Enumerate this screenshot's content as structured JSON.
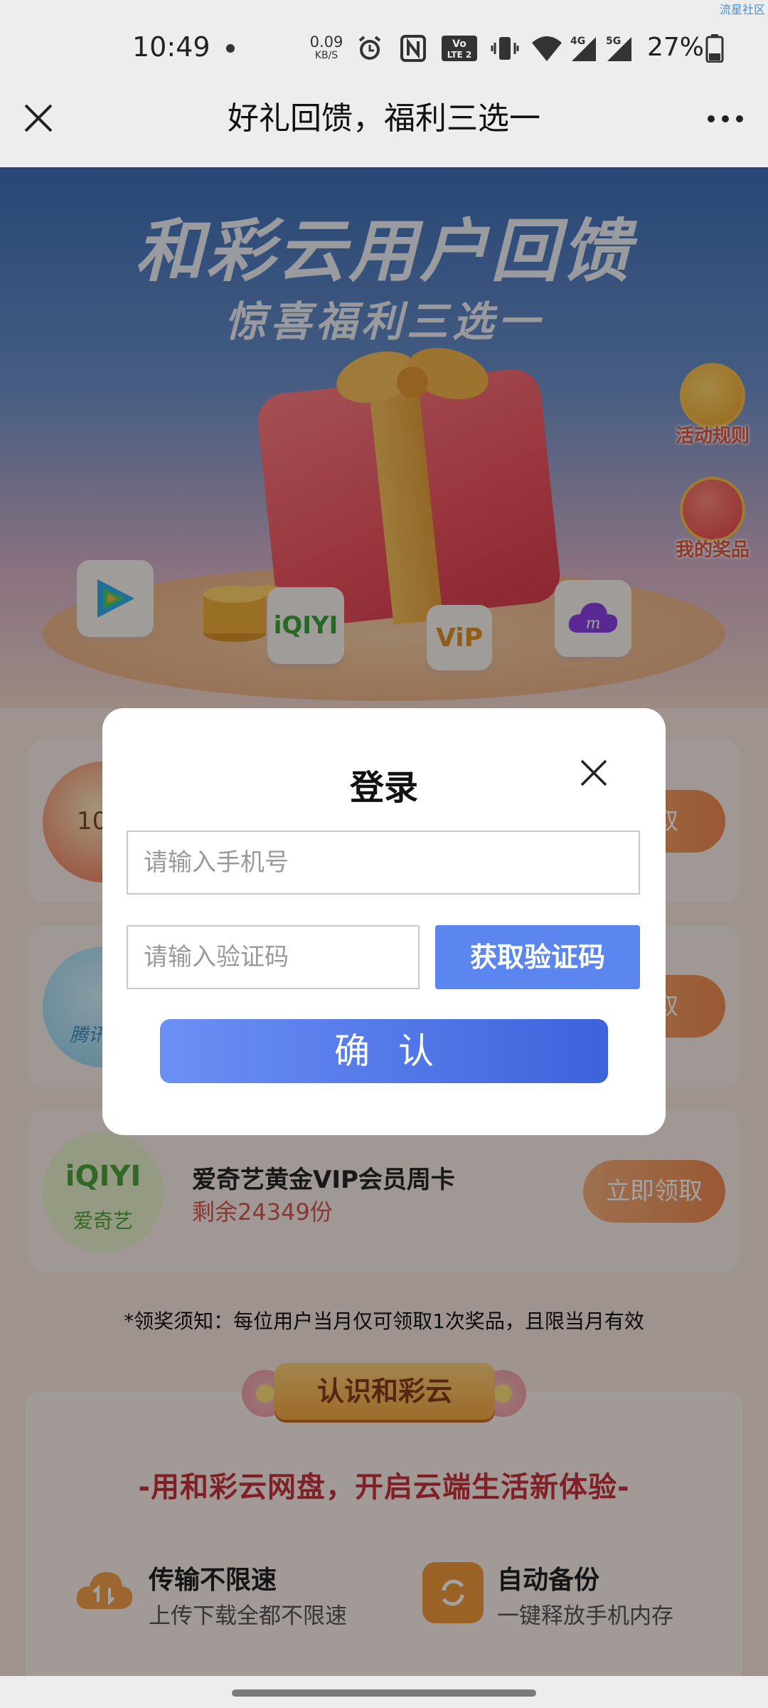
{
  "status_bar": {
    "time": "10:49",
    "net_speed_value": "0.09",
    "net_speed_unit": "KB/S",
    "battery_percent": "27%",
    "icons": [
      "alarm-icon",
      "nfc-icon",
      "volte-icon",
      "vibrate-icon",
      "wifi-icon",
      "signal-4g-icon",
      "signal-5g-icon",
      "battery-icon"
    ],
    "watermark": "流星社区"
  },
  "nav": {
    "title": "好礼回馈，福利三选一",
    "close_icon": "close-icon",
    "more_icon": "more-icon"
  },
  "banner": {
    "title": "和彩云用户回馈",
    "subtitle": "惊喜福利三选一",
    "rules_label": "活动规则",
    "prizes_label": "我的奖品",
    "tiles": [
      "tencent-video-icon",
      "iqiyi-icon",
      "vip-icon",
      "caiyun-cloud-icon"
    ],
    "iqiyi_text": "iQIYI",
    "vip_text": "ViP"
  },
  "cards": [
    {
      "claim": "领取",
      "avatar_text": "10"
    },
    {
      "claim": "领取",
      "avatar_text": "腾讯"
    },
    {
      "name": "爱奇艺黄金VIP会员周卡",
      "remain": "剩余24349份",
      "claim": "立即领取",
      "avatar_text": "iQIYI",
      "avatar_sub": "爱奇艺"
    }
  ],
  "notice": "*领奖须知：每位用户当月仅可领取1次奖品，且限当月有效",
  "know": {
    "tag": "认识和彩云",
    "slogan": "-用和彩云网盘，开启云端生活新体验-",
    "features": [
      {
        "title": "传输不限速",
        "desc": "上传下载全都不限速"
      },
      {
        "title": "自动备份",
        "desc": "一键释放手机内存"
      }
    ]
  },
  "login_modal": {
    "title": "登录",
    "phone_placeholder": "请输入手机号",
    "code_placeholder": "请输入验证码",
    "get_code_label": "获取验证码",
    "confirm_label": "确认"
  },
  "colors": {
    "accent_blue": "#5b86f0",
    "confirm_gradient_end": "#3d63dc",
    "claim_orange": "#f08b4f",
    "remain_red": "#d8574e"
  }
}
